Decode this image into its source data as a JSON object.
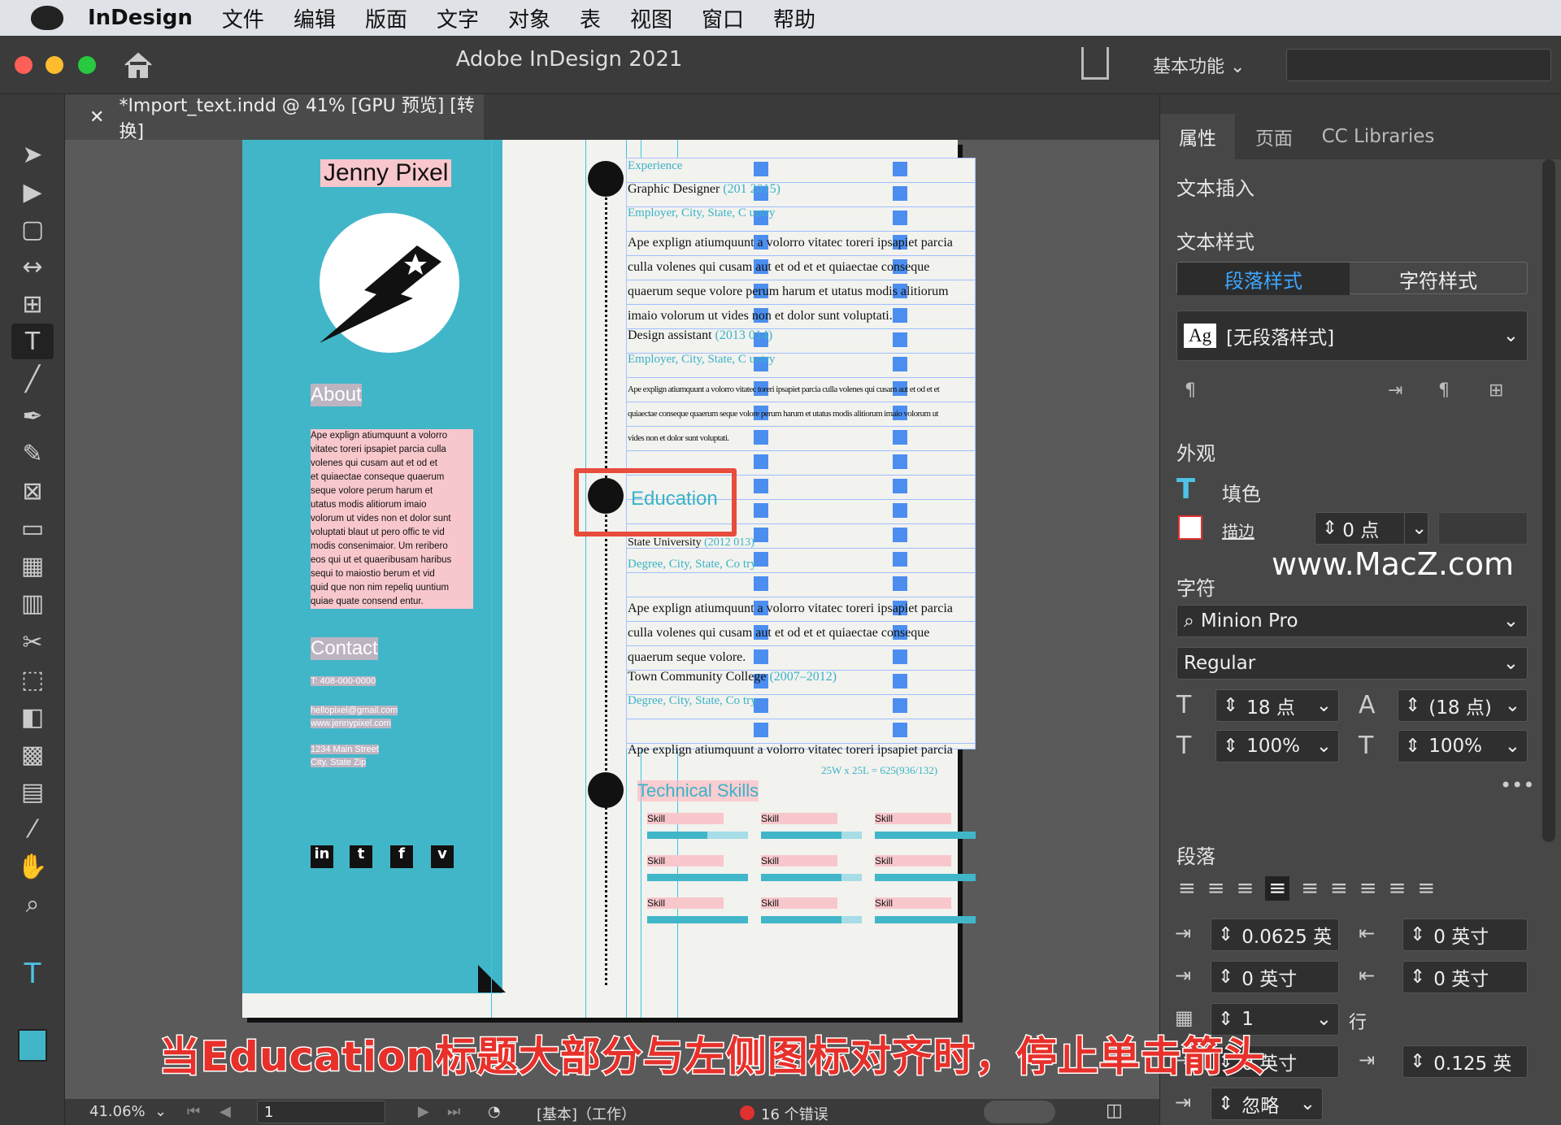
{
  "menubar": {
    "app": "InDesign",
    "items": [
      "文件",
      "编辑",
      "版面",
      "文字",
      "对象",
      "表",
      "视图",
      "窗口",
      "帮助"
    ]
  },
  "titlebar": {
    "title": "Adobe InDesign 2021",
    "workspace": "基本功能 ⌄"
  },
  "document": {
    "tab": "*Import_text.indd @ 41% [GPU 预览] [转换]"
  },
  "resume": {
    "name": "Jenny Pixel",
    "about_title": "About",
    "about_lines": [
      "Ape explign atiumquunt a volorro",
      "vitatec toreri ipsapiet parcia culla",
      "volenes qui cusam aut et od et",
      "et quiaectae conseque quaerum",
      "seque volore perum harum et",
      "utatus modis alitiorum imaio",
      "volorum ut vides non et dolor sunt",
      "voluptati blaut ut pero offic te vid",
      "modis consenimaior. Um reribero",
      "eos qui ut et quaeribusam haribus",
      "sequi to maiostio berum et vid",
      "quid que non nim repeliq uuntium",
      "quiae quate consend entur."
    ],
    "contact_title": "Contact",
    "phone": "T: 408-000-0000",
    "email": "hellopixel@gmail.com",
    "web": "www.jennypixel.com",
    "street": "1234 Main Street",
    "city": "City, State Zip",
    "social": [
      "in",
      "t",
      "f",
      "v"
    ],
    "experience_label": "Experience",
    "job1": "Graphic Designer",
    "job1_years": "(201   2015)",
    "employer": "Employer, City, State, C  untry",
    "para1": [
      "Ape explign atiumquunt a volorro vitatec toreri ipsapiet parcia",
      "culla volenes qui cusam aut et od et et quiaectae conseque",
      "quaerum seque volore perum harum et utatus modis alitiorum",
      "imaio volorum ut vides non et dolor sunt voluptati."
    ],
    "job2": "Design assistant",
    "job2_years": "(2013  014)",
    "para2": [
      "Ape explign atiumquunt a volorro vitatec toreri ipsapiet parcia culla volenes qui cusam aut et od et et",
      "quiaectae conseque quaerum seque volore perum harum et utatus modis alitiorum imaio volorum ut",
      "vides non et dolor sunt voluptati."
    ],
    "education_label": "Education",
    "school1": "State University",
    "school1_years": "(2012  013)",
    "degree": "Degree, City, State, Co   try",
    "para3": [
      "Ape explign atiumquunt a volorro vitatec toreri ipsapiet parcia",
      "culla volenes qui cusam aut et od et et quiaectae conseque",
      "quaerum seque volore."
    ],
    "school2": "Town Community College",
    "school2_years": "(2007–2012)",
    "para4": "Ape explign atiumquunt a volorro vitatec toreri ipsapiet parcia",
    "overset": "25W x 25L = 625(936/132)",
    "skills_label": "Technical Skills",
    "skill": "Skill",
    "skill_levels": [
      0.6,
      0.8,
      1.0,
      1.0,
      0.8,
      1.0,
      1.0,
      0.8,
      1.0
    ]
  },
  "panel": {
    "tabs": [
      "属性",
      "页面",
      "CC Libraries"
    ],
    "text_insert": "文本插入",
    "text_style": "文本样式",
    "para_style_btn": "段落样式",
    "char_style_btn": "字符样式",
    "style_icon": "Ag",
    "style_value": "[无段落样式]",
    "appearance": "外观",
    "fill": "填色",
    "stroke": "描边",
    "stroke_value": "0 点",
    "character": "字符",
    "font": "Minion Pro",
    "font_style": "Regular",
    "size": "18 点",
    "leading": "(18 点)",
    "vscale": "100%",
    "hscale": "100%",
    "paragraph": "段落",
    "left_indent": "0.0625 英",
    "right_indent": "0 英寸",
    "first_indent": "0 英寸",
    "last_indent": "0 英寸",
    "drop_lines": "1",
    "drop_unit": "行",
    "space_before": "0 英寸",
    "space_after": "0.125 英",
    "grid_align": "忽略"
  },
  "status": {
    "zoom": "41.06%",
    "page": "1",
    "profile": "[基本]（工作）",
    "errors": "16 个错误"
  },
  "caption": "当Education标题大部分与左侧图标对齐时，停止单击箭头",
  "watermark": "www.MacZ.com",
  "colors": {
    "accent": "#42b6c9",
    "highlight": "#e74c3c",
    "error": "#e03030"
  }
}
